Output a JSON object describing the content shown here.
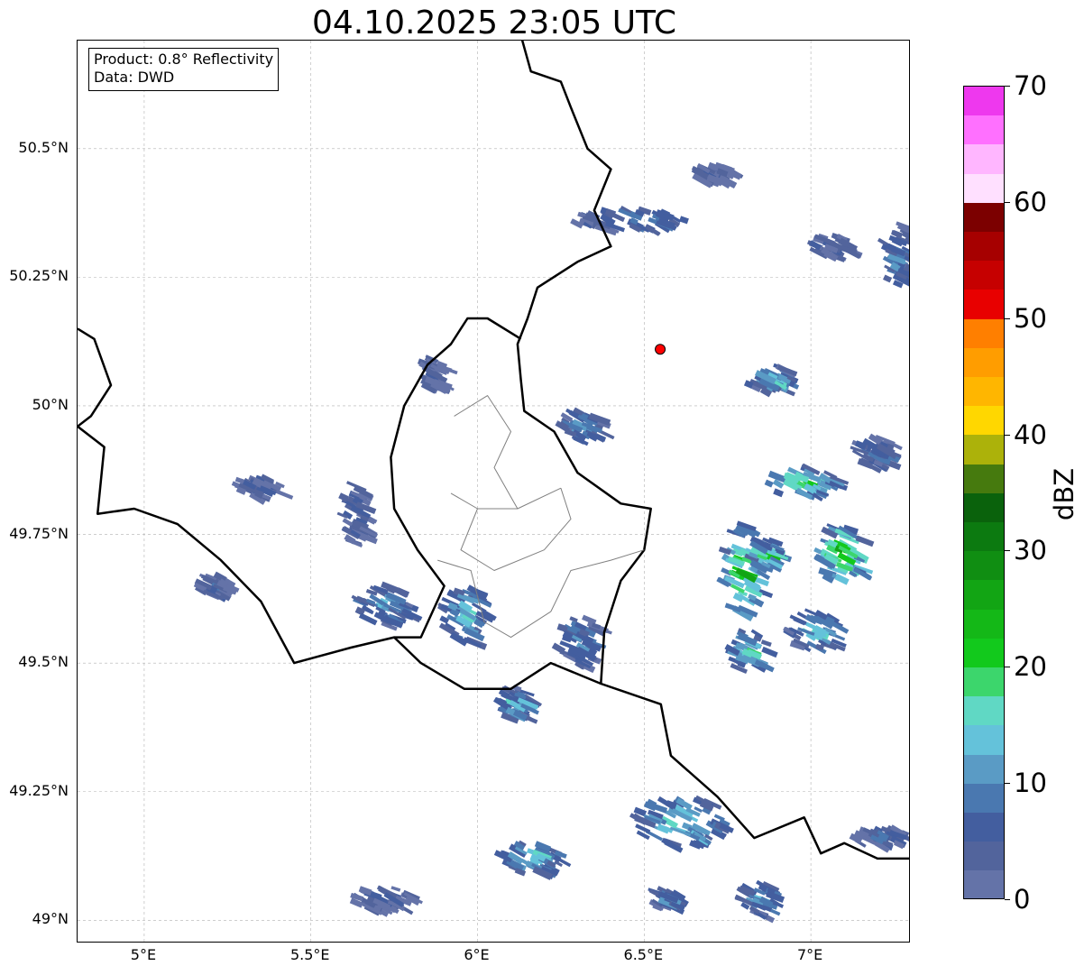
{
  "title": "04.10.2025 23:05 UTC",
  "info": {
    "product": "Product: 0.8° Reflectivity",
    "data": "Data: DWD"
  },
  "map": {
    "lon_range": [
      4.8,
      7.3
    ],
    "lat_range": [
      48.955,
      50.71
    ],
    "lat_ticks": [
      {
        "value": 49.0,
        "label": "49°N"
      },
      {
        "value": 49.25,
        "label": "49.25°N"
      },
      {
        "value": 49.5,
        "label": "49.5°N"
      },
      {
        "value": 49.75,
        "label": "49.75°N"
      },
      {
        "value": 50.0,
        "label": "50°N"
      },
      {
        "value": 50.25,
        "label": "50.25°N"
      },
      {
        "value": 50.5,
        "label": "50.5°N"
      }
    ],
    "lon_ticks": [
      {
        "value": 5.0,
        "label": "5°E"
      },
      {
        "value": 5.5,
        "label": "5.5°E"
      },
      {
        "value": 6.0,
        "label": "6°E"
      },
      {
        "value": 6.5,
        "label": "6.5°E"
      },
      {
        "value": 7.0,
        "label": "7°E"
      }
    ],
    "radar_site": {
      "lon": 6.548,
      "lat": 50.11,
      "color": "#ff0000"
    }
  },
  "colorbar": {
    "label": "dBZ",
    "min": 0,
    "max": 70,
    "ticks": [
      0,
      10,
      20,
      30,
      40,
      50,
      60,
      70
    ],
    "colors": [
      "#6473a8",
      "#52649c",
      "#435e9f",
      "#4a78b0",
      "#5a9bc5",
      "#64c2da",
      "#60d8c4",
      "#3cd66c",
      "#12c91c",
      "#14b817",
      "#12a514",
      "#108e12",
      "#0c7a10",
      "#0a620c",
      "#467a0e",
      "#acb20a",
      "#ffd700",
      "#ffb600",
      "#ff9d00",
      "#ff7f00",
      "#e80000",
      "#c60000",
      "#a60000",
      "#7c0000",
      "#ffe0ff",
      "#ffb6ff",
      "#ff70ff",
      "#ee38ee"
    ]
  },
  "echoes": [
    {
      "lon": 6.78,
      "lat": 49.69,
      "rx": 0.06,
      "ry": 0.09,
      "dbz": 26
    },
    {
      "lon": 6.85,
      "lat": 49.72,
      "rx": 0.05,
      "ry": 0.03,
      "dbz": 24
    },
    {
      "lon": 7.08,
      "lat": 49.72,
      "rx": 0.07,
      "ry": 0.06,
      "dbz": 26
    },
    {
      "lon": 6.96,
      "lat": 49.86,
      "rx": 0.11,
      "ry": 0.03,
      "dbz": 22
    },
    {
      "lon": 6.8,
      "lat": 49.53,
      "rx": 0.06,
      "ry": 0.04,
      "dbz": 18
    },
    {
      "lon": 7.0,
      "lat": 49.57,
      "rx": 0.08,
      "ry": 0.04,
      "dbz": 16
    },
    {
      "lon": 6.87,
      "lat": 50.06,
      "rx": 0.07,
      "ry": 0.025,
      "dbz": 15
    },
    {
      "lon": 6.3,
      "lat": 49.97,
      "rx": 0.06,
      "ry": 0.03,
      "dbz": 14
    },
    {
      "lon": 6.1,
      "lat": 49.43,
      "rx": 0.05,
      "ry": 0.03,
      "dbz": 16
    },
    {
      "lon": 6.6,
      "lat": 49.2,
      "rx": 0.14,
      "ry": 0.05,
      "dbz": 18
    },
    {
      "lon": 6.15,
      "lat": 49.13,
      "rx": 0.1,
      "ry": 0.03,
      "dbz": 17
    },
    {
      "lon": 5.95,
      "lat": 49.6,
      "rx": 0.07,
      "ry": 0.06,
      "dbz": 16
    },
    {
      "lon": 5.7,
      "lat": 49.62,
      "rx": 0.09,
      "ry": 0.04,
      "dbz": 12
    },
    {
      "lon": 6.45,
      "lat": 50.37,
      "rx": 0.18,
      "ry": 0.02,
      "dbz": 12
    },
    {
      "lon": 7.25,
      "lat": 50.3,
      "rx": 0.05,
      "ry": 0.06,
      "dbz": 10
    },
    {
      "lon": 7.18,
      "lat": 49.92,
      "rx": 0.06,
      "ry": 0.03,
      "dbz": 9
    },
    {
      "lon": 6.3,
      "lat": 49.55,
      "rx": 0.07,
      "ry": 0.05,
      "dbz": 11
    },
    {
      "lon": 5.62,
      "lat": 49.8,
      "rx": 0.04,
      "ry": 0.06,
      "dbz": 8
    },
    {
      "lon": 5.33,
      "lat": 49.85,
      "rx": 0.07,
      "ry": 0.02,
      "dbz": 6
    },
    {
      "lon": 6.83,
      "lat": 49.05,
      "rx": 0.06,
      "ry": 0.03,
      "dbz": 12
    },
    {
      "lon": 6.55,
      "lat": 49.05,
      "rx": 0.05,
      "ry": 0.02,
      "dbz": 10
    },
    {
      "lon": 7.2,
      "lat": 49.17,
      "rx": 0.08,
      "ry": 0.02,
      "dbz": 7
    },
    {
      "lon": 7.05,
      "lat": 50.32,
      "rx": 0.06,
      "ry": 0.02,
      "dbz": 6
    },
    {
      "lon": 5.85,
      "lat": 50.07,
      "rx": 0.04,
      "ry": 0.03,
      "dbz": 5
    },
    {
      "lon": 6.7,
      "lat": 50.46,
      "rx": 0.06,
      "ry": 0.015,
      "dbz": 5
    },
    {
      "lon": 5.2,
      "lat": 49.66,
      "rx": 0.05,
      "ry": 0.02,
      "dbz": 7
    },
    {
      "lon": 5.7,
      "lat": 49.05,
      "rx": 0.1,
      "ry": 0.02,
      "dbz": 5
    }
  ]
}
